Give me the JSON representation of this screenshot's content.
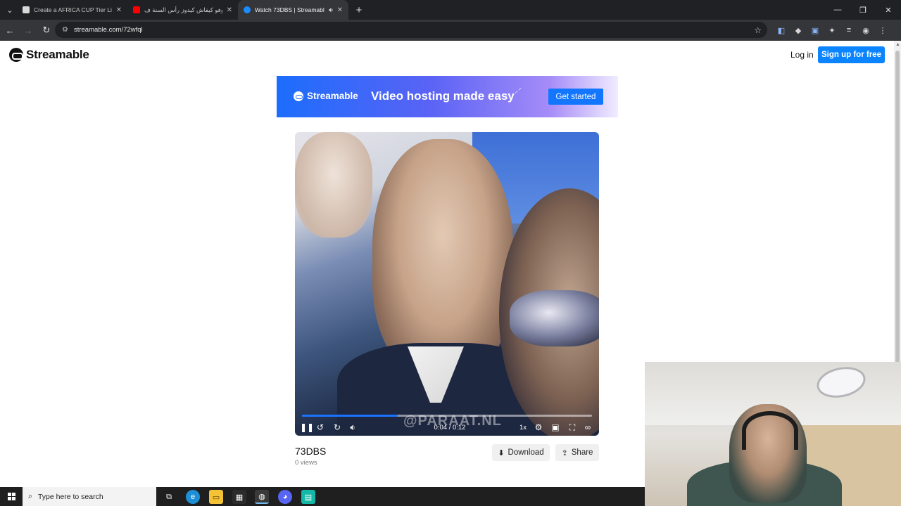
{
  "browser": {
    "tabs": [
      {
        "title": "Create a AFRICA CUP Tier List -",
        "active": false
      },
      {
        "title": "شوفو كيفاش كيدوز رأس السنة ف",
        "active": false
      },
      {
        "title": "Watch 73DBS | Streamable",
        "active": true
      }
    ],
    "url": "streamable.com/72wfql"
  },
  "site": {
    "brand": "Streamable",
    "login": "Log in",
    "signup": "Sign up for free"
  },
  "banner": {
    "brand": "Streamable",
    "tagline": "Video hosting made easy",
    "cta": "Get started"
  },
  "video": {
    "watermark": "@PARAAT.NL",
    "time": "0:04 / 0:12",
    "progress": 0.33,
    "speed": "1x",
    "title": "73DBS",
    "views": "0 views",
    "download_label": "Download",
    "share_label": "Share"
  },
  "taskbar": {
    "search_placeholder": "Type here to search"
  },
  "colors": {
    "accent": "#0a84ff",
    "tab_bg": "#202124",
    "toolbar_bg": "#35363a"
  }
}
